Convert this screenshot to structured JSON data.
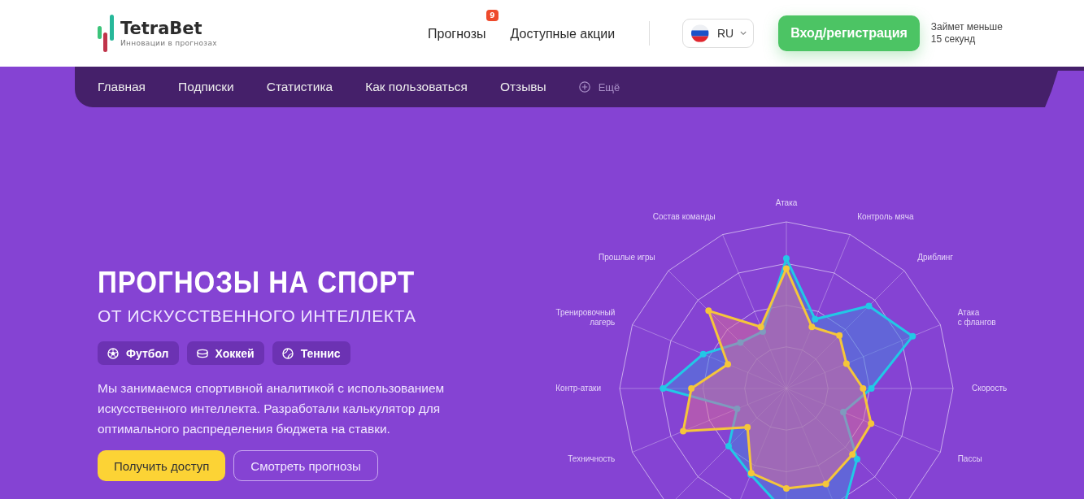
{
  "header": {
    "logo": {
      "name": "TetraBet",
      "tagline": "Инновации в прогнозах"
    },
    "links": [
      {
        "label": "Прогнозы",
        "badge": "9"
      },
      {
        "label": "Доступные акции"
      }
    ],
    "language": {
      "code": "RU"
    },
    "login_button": "Вход/регистрация",
    "login_note": "Займет меньше\n15 секунд"
  },
  "nav": {
    "items": [
      {
        "label": "Главная",
        "kind": "link"
      },
      {
        "label": "Подписки",
        "kind": "link"
      },
      {
        "label": "Статистика",
        "kind": "link"
      },
      {
        "label": "Как пользоваться",
        "kind": "link"
      },
      {
        "label": "Отзывы",
        "kind": "link"
      },
      {
        "label": "Ещё",
        "kind": "more"
      }
    ]
  },
  "hero": {
    "title": "ПРОГНОЗЫ НА СПОРТ",
    "subtitle": "ОТ ИСКУССТВЕННОГО ИНТЕЛЛЕКТА",
    "sports": [
      {
        "label": "Футбол",
        "kind": "football"
      },
      {
        "label": "Хоккей",
        "kind": "hockey"
      },
      {
        "label": "Теннис",
        "kind": "tennis"
      }
    ],
    "text": "Мы занимаемся спортивной аналитикой с использованием искусственного интеллекта. Разработали калькулятор для оптимального распределения бюджета на ставки.",
    "buttons": [
      {
        "label": "Получить доступ",
        "kind": "primary"
      },
      {
        "label": "Смотреть прогнозы",
        "kind": "outline"
      }
    ]
  },
  "radar": {
    "labels_right": [
      "Атака",
      "Контроль мяча",
      "Дриблинг",
      "Атака\nс флангов",
      "Скорость",
      "Пассы"
    ],
    "labels_left": [
      "Состав команды",
      "Прошлые игры",
      "Тренировочный\nлагерь",
      "Контр-атаки",
      "Техничность"
    ]
  }
}
